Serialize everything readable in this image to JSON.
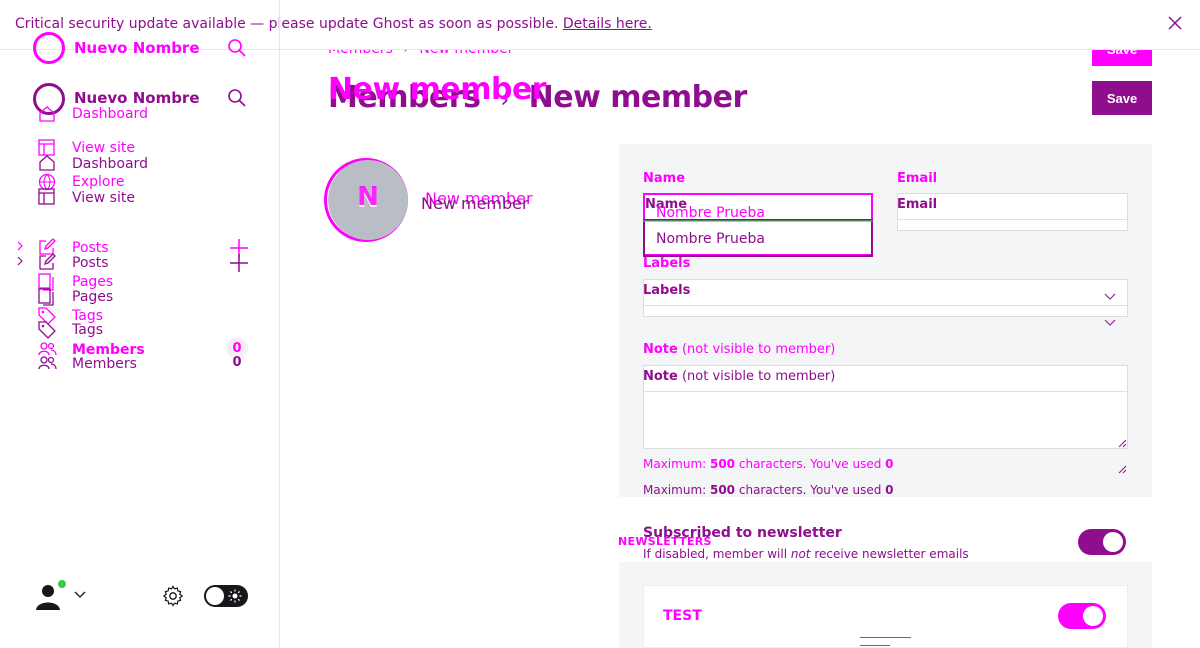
{
  "banner": {
    "text": "Critical security update available — please update Ghost as soon as possible. ",
    "link": "Details here."
  },
  "sidebar": {
    "site_name": "Nuevo Nombre",
    "nav": {
      "dashboard": "Dashboard",
      "view_site": "View site",
      "explore": "Explore",
      "posts": "Posts",
      "pages": "Pages",
      "tags": "Tags",
      "members": "Members",
      "members_count": "0"
    }
  },
  "header": {
    "breadcrumb_parent": "Members",
    "breadcrumb_sep": "›",
    "breadcrumb_current": "New member",
    "title_parent": "Members",
    "title_current": "New member",
    "save_label": "Save"
  },
  "member": {
    "initial": "N",
    "display_name": "New member"
  },
  "form": {
    "name_label": "Name",
    "name_value": "Nombre Prueba",
    "email_label": "Email",
    "labels_label": "Labels",
    "note_label": "Note",
    "note_sub": " (not visible to member)",
    "hint_prefix": "Maximum: ",
    "hint_max": "500",
    "hint_mid": " characters. You've used ",
    "hint_used": "0"
  },
  "newsletter": {
    "section_label": "NEWSLETTERS",
    "title": "Subscribed to newsletter",
    "desc_prefix": "If disabled, member will ",
    "desc_em": "not",
    "desc_suffix": " receive newsletter emails",
    "item_name": "TEST"
  },
  "colors": {
    "magenta": "#ff00ff",
    "purple": "#8e0e8e",
    "avatar_gray": "#b9bec6",
    "toggle_dark": "#15171a",
    "online_green": "#30cf43"
  }
}
